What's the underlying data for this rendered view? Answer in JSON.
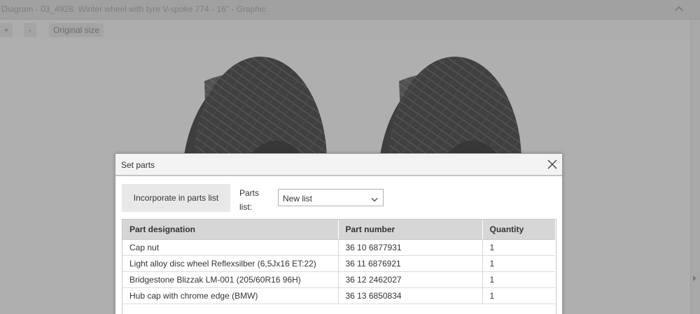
{
  "window": {
    "title": "Diagram - 03_4928: Winter wheel with tyre V-spoke 774 - 16\" - Graphic",
    "collapse_icon": "chevron-up-icon"
  },
  "zoom": {
    "zoom_in_label": "+",
    "zoom_out_label": "-",
    "original_size_label": "Original size"
  },
  "dialog": {
    "title": "Set parts",
    "close_icon": "close-icon",
    "incorporate_label": "Incorporate in parts list",
    "parts_list_label": "Parts list:",
    "parts_list_value": "New list",
    "table": {
      "headers": [
        "Part designation",
        "Part number",
        "Quantity"
      ],
      "rows": [
        [
          "Cap nut",
          "36 10 6877931",
          "1"
        ],
        [
          "Light alloy disc wheel Reflexsilber (6,5Jx16 ET:22)",
          "36 11 6876921",
          "1"
        ],
        [
          "Bridgestone Blizzak LM-001 (205/60R16 96H)",
          "36 12 2462027",
          "1"
        ],
        [
          "Hub cap with chrome edge (BMW)",
          "36 13 6850834",
          "1"
        ]
      ]
    }
  },
  "colors": {
    "overlay": "#5a5a5a",
    "dialog_header_border": "#b8c7d6",
    "table_header_bg": "#d6d6d6"
  }
}
